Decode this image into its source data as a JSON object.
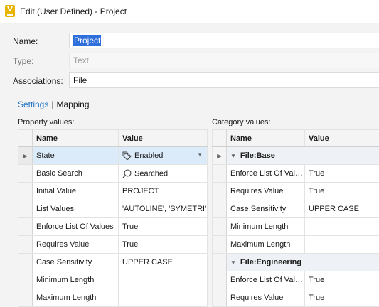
{
  "window": {
    "title": "Edit (User Defined) - Project",
    "app_icon_letter": "V"
  },
  "form": {
    "name_label": "Name:",
    "name_value": "Project",
    "type_label": "Type:",
    "type_value": "Text",
    "associations_label": "Associations:",
    "associations_value": "File"
  },
  "tabs": {
    "settings": "Settings",
    "mapping": "Mapping",
    "separator": "|"
  },
  "property_values": {
    "label": "Property values:",
    "headers": {
      "name": "Name",
      "value": "Value"
    },
    "rows": [
      {
        "name": "State",
        "value": "Enabled",
        "icon": "tag-icon",
        "selected": true
      },
      {
        "name": "Basic Search",
        "value": "Searched",
        "icon": "search-icon"
      },
      {
        "name": "Initial Value",
        "value": "PROJECT"
      },
      {
        "name": "List Values",
        "value": "'AUTOLINE', 'SYMETRI'"
      },
      {
        "name": "Enforce List Of Values",
        "value": "True"
      },
      {
        "name": "Requires Value",
        "value": "True"
      },
      {
        "name": "Case Sensitivity",
        "value": "UPPER CASE"
      },
      {
        "name": "Minimum Length",
        "value": ""
      },
      {
        "name": "Maximum Length",
        "value": ""
      }
    ]
  },
  "category_values": {
    "label": "Category values:",
    "headers": {
      "name": "Name",
      "value": "Value"
    },
    "groups": [
      {
        "title": "File:Base",
        "rows": [
          {
            "name": "Enforce List Of Values",
            "value": "True"
          },
          {
            "name": "Requires Value",
            "value": "True"
          },
          {
            "name": "Case Sensitivity",
            "value": "UPPER CASE"
          },
          {
            "name": "Minimum Length",
            "value": ""
          },
          {
            "name": "Maximum Length",
            "value": ""
          }
        ]
      },
      {
        "title": "File:Engineering",
        "rows": [
          {
            "name": "Enforce List Of Values",
            "value": "True"
          },
          {
            "name": "Requires Value",
            "value": "True"
          }
        ]
      }
    ]
  },
  "colors": {
    "accent": "#2273c5",
    "selection": "#2f6fdc",
    "row_selected": "#dcebfa",
    "app_icon": "#e8b400"
  }
}
